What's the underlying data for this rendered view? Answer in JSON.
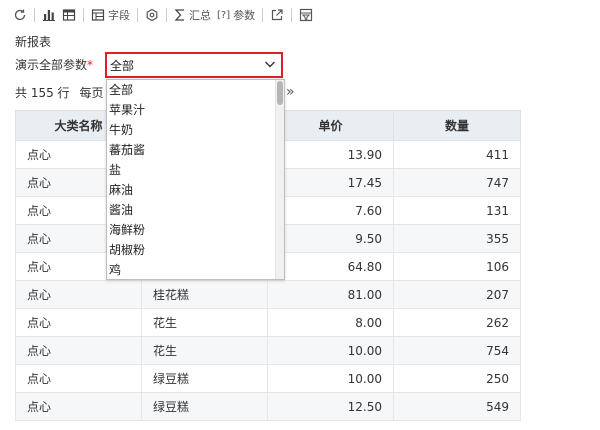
{
  "toolbar": {
    "field_label": "字段",
    "sum_label": "汇总",
    "param_label": "参数",
    "param_bracket": "[?]"
  },
  "report": {
    "title": "新报表"
  },
  "param": {
    "label": "演示全部参数",
    "required_mark": "*",
    "value": "全部",
    "options": [
      "全部",
      "苹果汁",
      "牛奶",
      "蕃茄酱",
      "盐",
      "麻油",
      "酱油",
      "海鲜粉",
      "胡椒粉",
      "鸡"
    ]
  },
  "pager": {
    "total_text": "共 155 行",
    "per_page_label": "每页",
    "next_glyph": "»"
  },
  "table": {
    "columns": [
      "大类名称",
      "",
      "单价",
      "数量"
    ],
    "rows": [
      [
        "点心",
        "",
        "13.90",
        "411"
      ],
      [
        "点心",
        "",
        "17.45",
        "747"
      ],
      [
        "点心",
        "",
        "7.60",
        "131"
      ],
      [
        "点心",
        "",
        "9.50",
        "355"
      ],
      [
        "点心",
        "",
        "64.80",
        "106"
      ],
      [
        "点心",
        "桂花糕",
        "81.00",
        "207"
      ],
      [
        "点心",
        "花生",
        "8.00",
        "262"
      ],
      [
        "点心",
        "花生",
        "10.00",
        "754"
      ],
      [
        "点心",
        "绿豆糕",
        "10.00",
        "250"
      ],
      [
        "点心",
        "绿豆糕",
        "12.50",
        "549"
      ]
    ]
  },
  "colors": {
    "required": "#e02020",
    "header_bg": "#e9eef2",
    "combo_border": "#e02020"
  },
  "icons": [
    "refresh-icon",
    "bar-chart-icon",
    "table-icon",
    "field-icon",
    "settings-icon",
    "sum-icon",
    "export-icon",
    "filter-icon"
  ]
}
